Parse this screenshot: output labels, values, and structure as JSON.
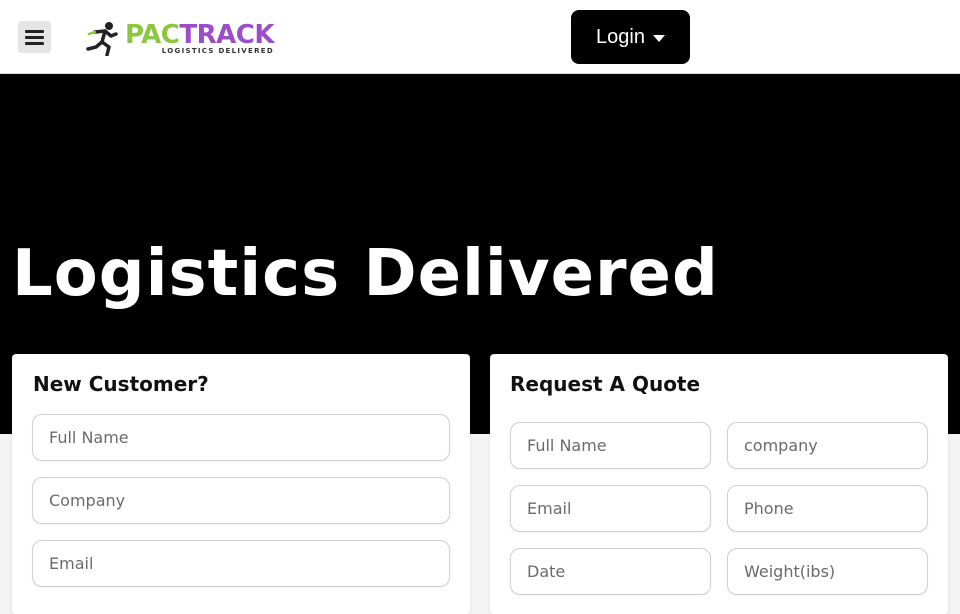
{
  "header": {
    "logo": {
      "part1": "PAC",
      "part2": "TRACK",
      "tagline": "LOGISTICS DELIVERED"
    },
    "login_label": "Login"
  },
  "hero": {
    "title": "Logistics Delivered"
  },
  "new_customer": {
    "title": "New Customer?",
    "fields": [
      "Full Name",
      "Company",
      "Email"
    ]
  },
  "quote": {
    "title": "Request A Quote",
    "fields": [
      "Full Name",
      "company",
      "Email",
      "Phone",
      "Date",
      "Weight(ibs)"
    ]
  },
  "colors": {
    "brand_green": "#8cc63f",
    "brand_purple": "#9b4dca",
    "hero_bg": "#000000"
  },
  "icons": {
    "menu": "hamburger-menu-icon",
    "login_caret": "caret-down-icon",
    "logo_runner": "runner-icon"
  }
}
